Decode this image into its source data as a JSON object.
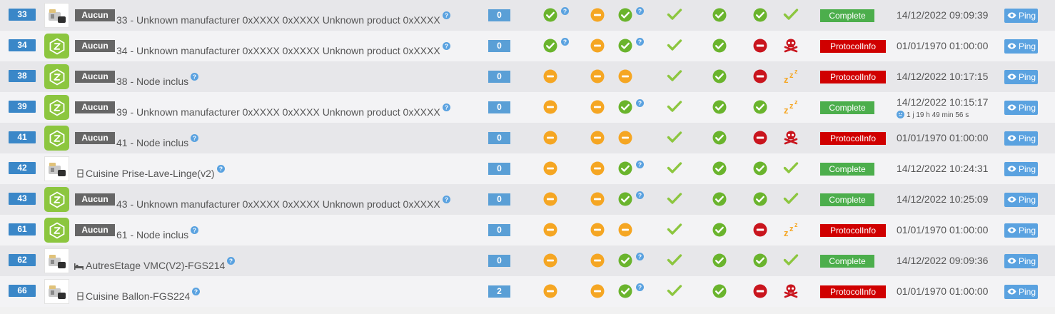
{
  "colors": {
    "green": "#8cc63f",
    "ok_circle": "#6ab42d",
    "orange": "#f5a623",
    "red": "#c9151e",
    "help_blue": "#5aa2e0",
    "complete": "#4cae4c",
    "protocolinfo": "#d00000"
  },
  "ping_label": "Ping",
  "rows": [
    {
      "id": "33",
      "object": "Aucun",
      "image": "device-photo",
      "name": "33 - Unknown manufacturer 0xXXXX 0xXXXX Unknown product 0xXXXX",
      "object_icon": "",
      "count": "0",
      "c1": "ok-help",
      "c2": "minus",
      "c3": "ok-help",
      "c4": "check",
      "c5": "ok",
      "c6": "ok",
      "c7": "check",
      "status": "Complete",
      "date": "14/12/2022 09:09:39",
      "sub": ""
    },
    {
      "id": "34",
      "object": "Aucun",
      "image": "zwave-logo",
      "name": "34 - Unknown manufacturer 0xXXXX 0xXXXX Unknown product 0xXXXX",
      "object_icon": "",
      "count": "0",
      "c1": "ok-help",
      "c2": "minus",
      "c3": "ok-help",
      "c4": "check",
      "c5": "ok",
      "c6": "stop",
      "c7": "skull",
      "status": "ProtocolInfo",
      "date": "01/01/1970 01:00:00",
      "sub": ""
    },
    {
      "id": "38",
      "object": "Aucun",
      "image": "zwave-logo",
      "name": "38 - Node inclus",
      "object_icon": "",
      "count": "0",
      "c1": "minus",
      "c2": "minus",
      "c3": "minus",
      "c4": "check",
      "c5": "ok",
      "c6": "stop",
      "c7": "sleep",
      "status": "ProtocolInfo",
      "date": "14/12/2022 10:17:15",
      "sub": ""
    },
    {
      "id": "39",
      "object": "Aucun",
      "image": "zwave-logo",
      "name": "39 - Unknown manufacturer 0xXXXX 0xXXXX Unknown product 0xXXXX",
      "object_icon": "",
      "count": "0",
      "c1": "minus",
      "c2": "minus",
      "c3": "ok-help",
      "c4": "check",
      "c5": "ok",
      "c6": "ok",
      "c7": "sleep",
      "status": "Complete",
      "date": "14/12/2022 10:15:17",
      "sub": "1 j 19 h 49 min 56 s"
    },
    {
      "id": "41",
      "object": "Aucun",
      "image": "zwave-logo",
      "name": "41 - Node inclus",
      "object_icon": "",
      "count": "0",
      "c1": "minus",
      "c2": "minus",
      "c3": "minus",
      "c4": "check",
      "c5": "ok",
      "c6": "stop",
      "c7": "skull",
      "status": "ProtocolInfo",
      "date": "01/01/1970 01:00:00",
      "sub": ""
    },
    {
      "id": "42",
      "object": "",
      "image": "device-photo",
      "name": "Cuisine Prise-Lave-Linge(v2)",
      "object_icon": "cabinet-icon",
      "count": "0",
      "c1": "minus",
      "c2": "minus",
      "c3": "ok-help",
      "c4": "check",
      "c5": "ok",
      "c6": "ok",
      "c7": "check",
      "status": "Complete",
      "date": "14/12/2022 10:24:31",
      "sub": ""
    },
    {
      "id": "43",
      "object": "Aucun",
      "image": "zwave-logo",
      "name": "43 - Unknown manufacturer 0xXXXX 0xXXXX Unknown product 0xXXXX",
      "object_icon": "",
      "count": "0",
      "c1": "minus",
      "c2": "minus",
      "c3": "ok-help",
      "c4": "check",
      "c5": "ok",
      "c6": "ok",
      "c7": "check",
      "status": "Complete",
      "date": "14/12/2022 10:25:09",
      "sub": ""
    },
    {
      "id": "61",
      "object": "Aucun",
      "image": "zwave-logo",
      "name": "61 - Node inclus",
      "object_icon": "",
      "count": "0",
      "c1": "minus",
      "c2": "minus",
      "c3": "minus",
      "c4": "check",
      "c5": "ok",
      "c6": "stop",
      "c7": "sleep",
      "status": "ProtocolInfo",
      "date": "01/01/1970 01:00:00",
      "sub": ""
    },
    {
      "id": "62",
      "object": "",
      "image": "device-photo",
      "name": "AutresEtage VMC(V2)-FGS214",
      "object_icon": "bed-icon",
      "count": "0",
      "c1": "minus",
      "c2": "minus",
      "c3": "ok-help",
      "c4": "check",
      "c5": "ok",
      "c6": "ok",
      "c7": "check",
      "status": "Complete",
      "date": "14/12/2022 09:09:36",
      "sub": ""
    },
    {
      "id": "66",
      "object": "",
      "image": "device-photo",
      "name": "Cuisine Ballon-FGS224",
      "object_icon": "cabinet-icon",
      "count": "2",
      "c1": "minus",
      "c2": "minus",
      "c3": "ok-help",
      "c4": "check",
      "c5": "ok",
      "c6": "stop",
      "c7": "skull",
      "status": "ProtocolInfo",
      "date": "01/01/1970 01:00:00",
      "sub": ""
    }
  ]
}
